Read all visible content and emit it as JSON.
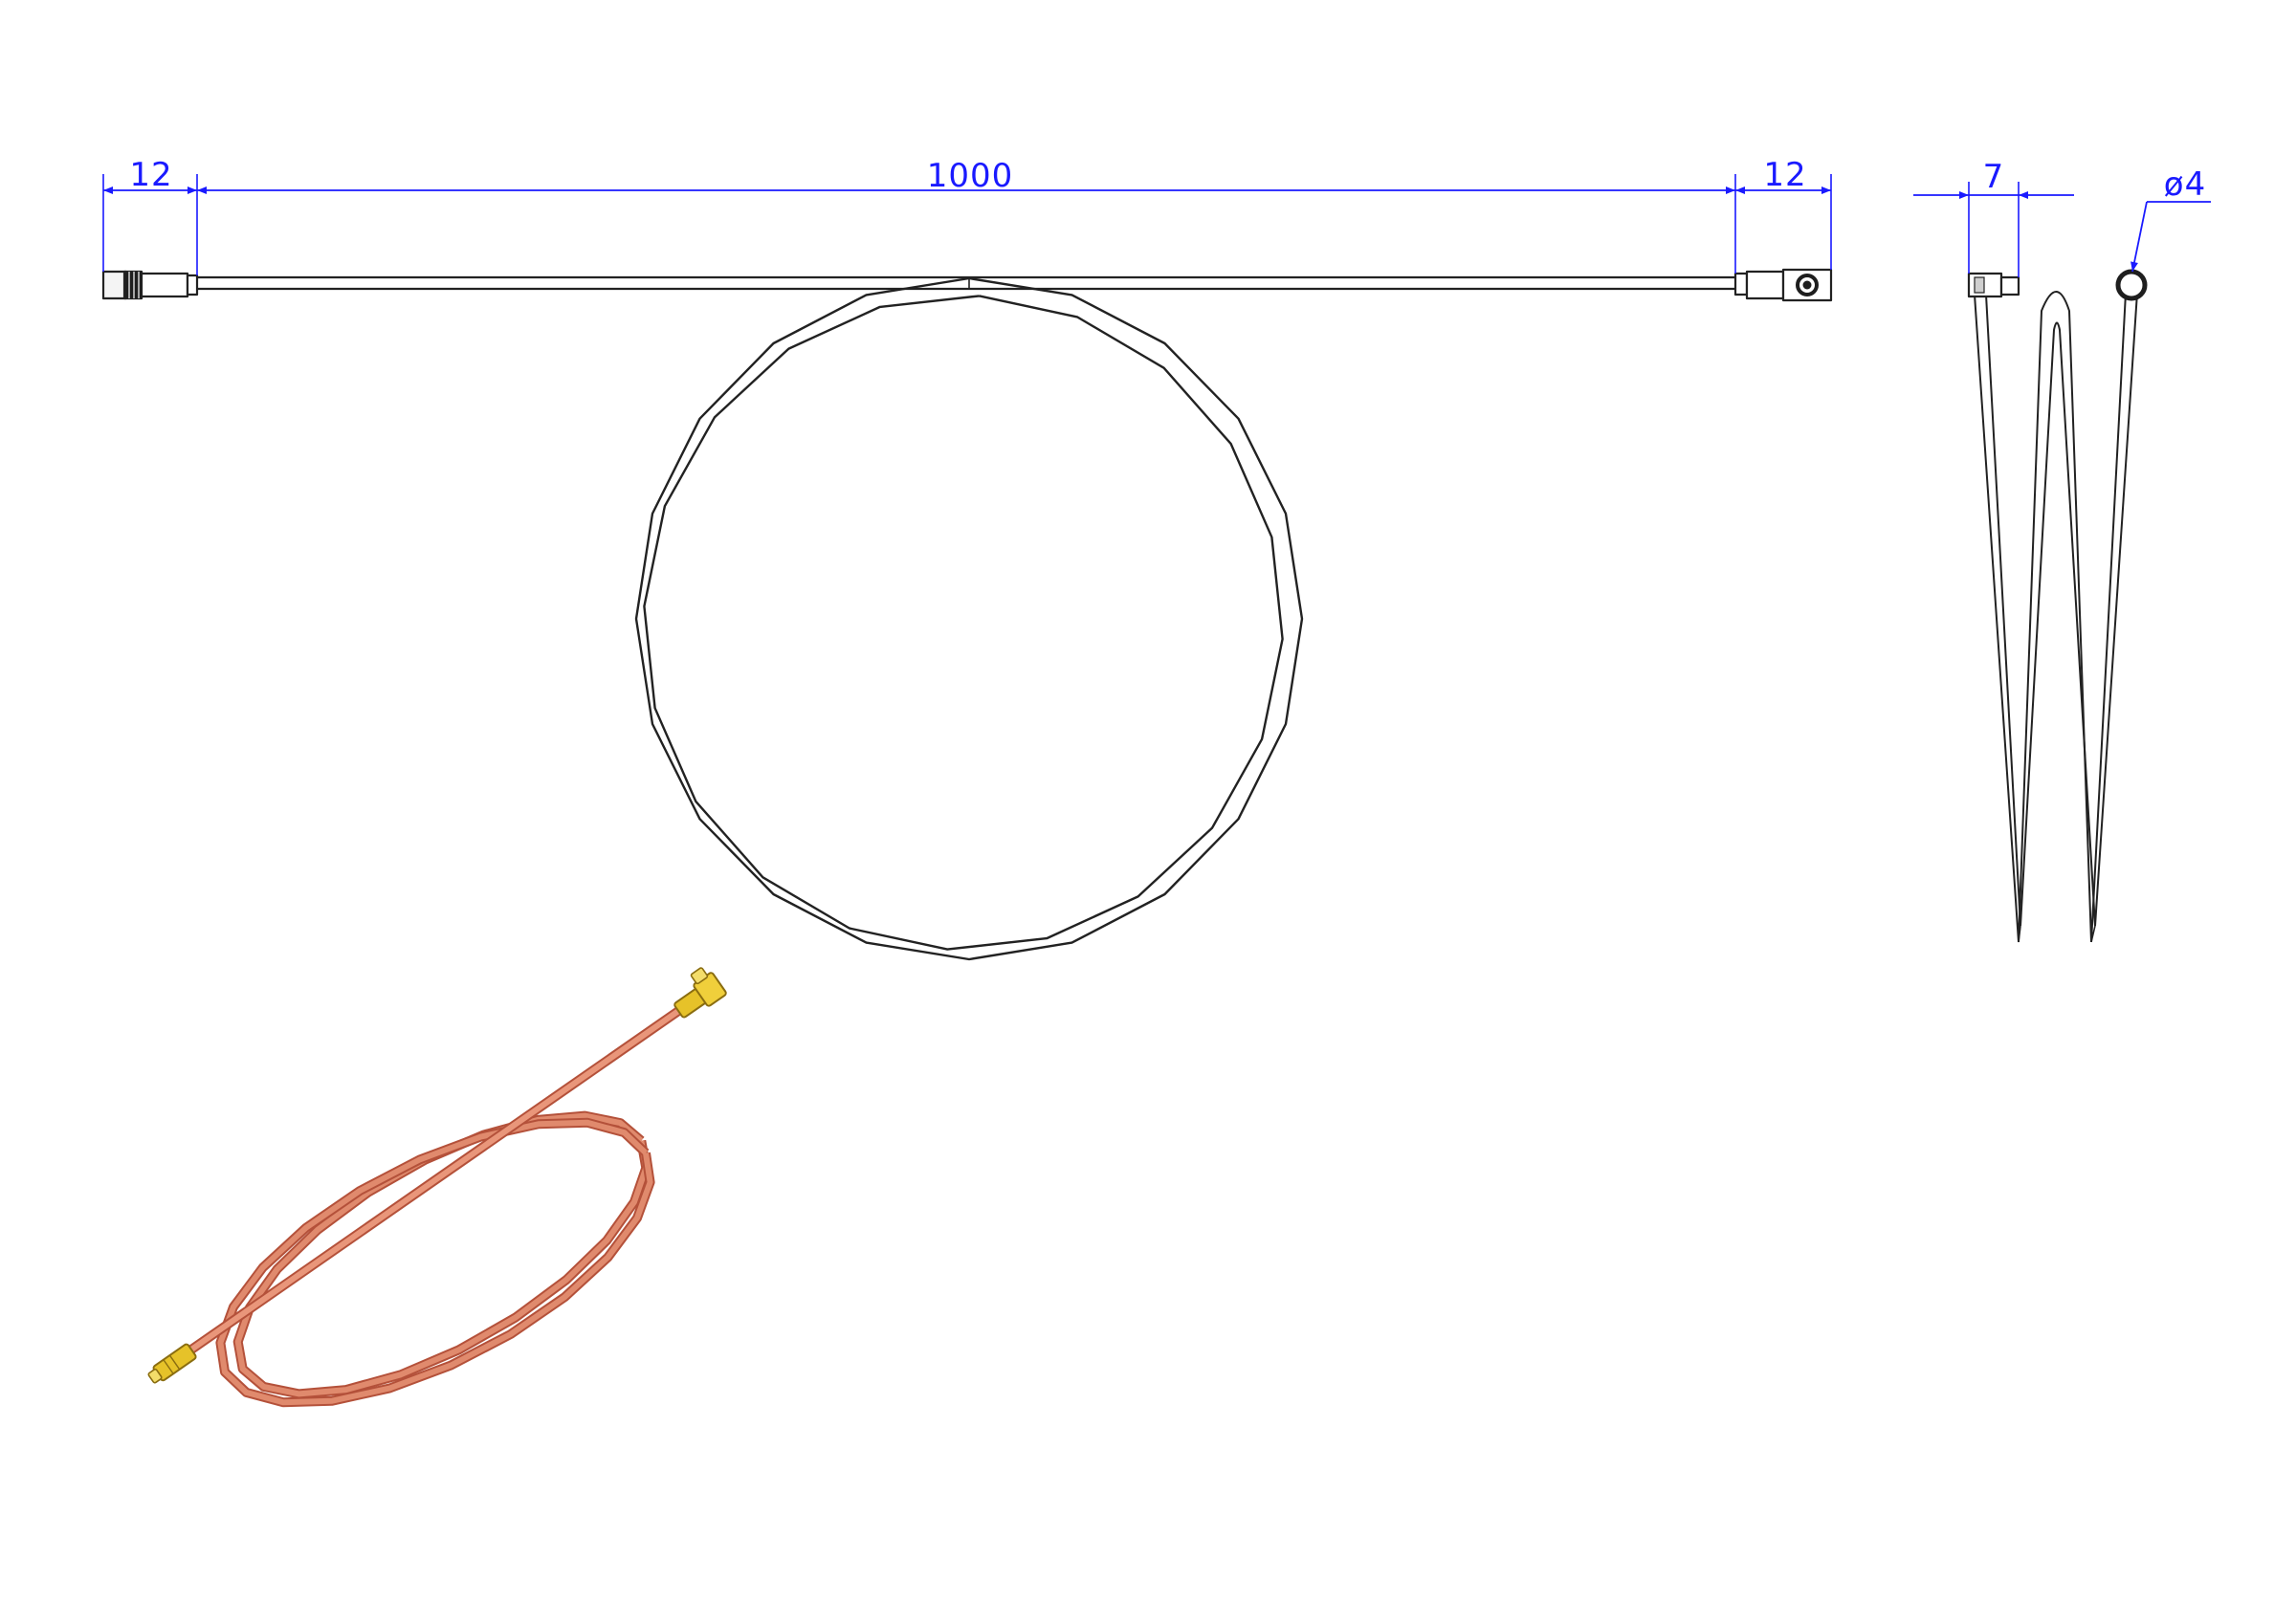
{
  "drawing": {
    "dimensions": {
      "left_connector_length": "12",
      "cable_length": "1000",
      "right_connector_length": "12",
      "side_connector_width": "7",
      "cable_diameter": "ø4"
    },
    "colors": {
      "dimension": "#1a1aff",
      "outline": "#222222",
      "cable_render": "#e08a6d",
      "cable_render_edge": "#b4513a",
      "connector_gold": "#e6c229"
    }
  }
}
